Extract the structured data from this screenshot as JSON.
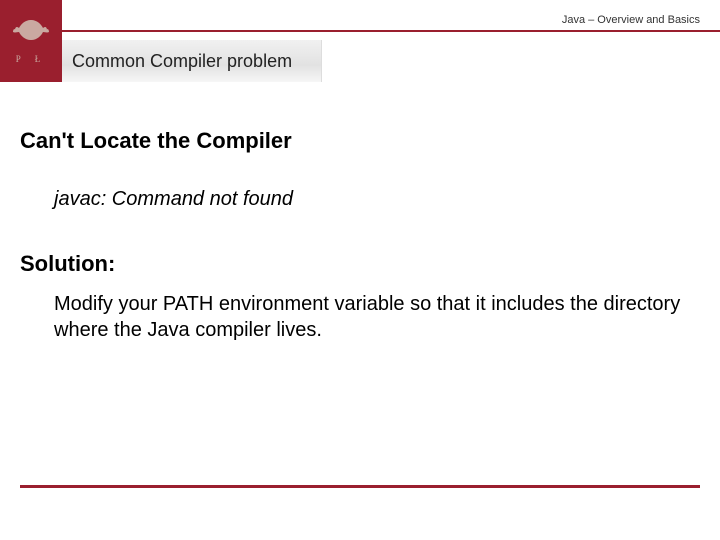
{
  "header": {
    "breadcrumb": "Java – Overview and Basics",
    "logo_letters": "P   Ł",
    "slide_title": "Common Compiler problem"
  },
  "body": {
    "heading": "Can't Locate the Compiler",
    "error_line": "javac: Command not found",
    "solution_label": "Solution:",
    "solution_text": "Modify your PATH environment variable so that it includes the directory where the Java compiler lives."
  },
  "colors": {
    "accent": "#9a1f2e"
  }
}
